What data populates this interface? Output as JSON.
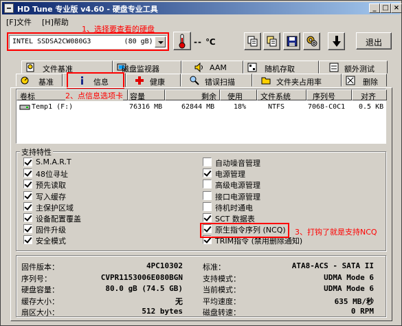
{
  "window": {
    "title": "HD Tune 专业版 v4.60 - 硬盘专业工具"
  },
  "menu": {
    "file": "[F]文件",
    "help": "[H]帮助"
  },
  "toolbar": {
    "device": "INTEL SSDSA2CW080G3        (80 gB)",
    "temperature": "-- ℃",
    "exit_label": "退出"
  },
  "annotations": {
    "step1": "1、选择要查看的硬盘",
    "step2": "2、点信息选项卡",
    "step3": "3、打钩了就是支持NCQ"
  },
  "tabs_row1": [
    "文件基准",
    "磁盘监视器",
    "AAM",
    "随机存取",
    "额外测试"
  ],
  "tabs_row2": [
    "基准",
    "信息",
    "健康",
    "错误扫描",
    "文件夹占用率",
    "删除"
  ],
  "volume_table": {
    "headers": [
      "卷标",
      "容量",
      "剩余",
      "使用",
      "文件系统",
      "序列号",
      "对齐"
    ],
    "rows": [
      [
        "Temp1 (F:)",
        "76316 MB",
        "62844 MB",
        "18%",
        "NTFS",
        "7068-C0C1",
        "0.5 KB"
      ]
    ]
  },
  "features": {
    "title": "支持特性",
    "left": [
      {
        "label": "S.M.A.R.T",
        "checked": true
      },
      {
        "label": "48位寻址",
        "checked": true
      },
      {
        "label": "预先读取",
        "checked": true
      },
      {
        "label": "写入缓存",
        "checked": true
      },
      {
        "label": "主保护区域",
        "checked": true
      },
      {
        "label": "设备配置覆盖",
        "checked": true
      },
      {
        "label": "固件升级",
        "checked": true
      },
      {
        "label": "安全模式",
        "checked": true
      }
    ],
    "right": [
      {
        "label": "自动噪音管理",
        "checked": false
      },
      {
        "label": "电源管理",
        "checked": true
      },
      {
        "label": "高级电源管理",
        "checked": false
      },
      {
        "label": "接口电源管理",
        "checked": false
      },
      {
        "label": "待机时通电",
        "checked": false
      },
      {
        "label": "SCT 数据表",
        "checked": true
      },
      {
        "label": "原生指令序列 (NCQ)",
        "checked": true
      },
      {
        "label": "TRIM指令 (禁用删除通知)",
        "checked": true
      }
    ]
  },
  "details": {
    "left": [
      {
        "label": "固件版本：",
        "value": "4PC10302"
      },
      {
        "label": "序列号：",
        "value": "CVPR1153006E080BGN"
      },
      {
        "label": "硬盘容量：",
        "value": "80.0 gB (74.5 GB)"
      },
      {
        "label": "缓存大小：",
        "value": "无"
      },
      {
        "label": "扇区大小：",
        "value": "512 bytes"
      }
    ],
    "right": [
      {
        "label": "标准：",
        "value": "ATA8-ACS - SATA II"
      },
      {
        "label": "支持模式：",
        "value": "UDMA Mode 6"
      },
      {
        "label": "当前模式：",
        "value": "UDMA Mode 6"
      },
      {
        "label": "平均速度：",
        "value": "635 MB/秒"
      },
      {
        "label": "磁盘转速：",
        "value": "0 RPM"
      }
    ]
  },
  "colors": {
    "annotation": "#ff0000",
    "titlebar": "#0a246a"
  }
}
